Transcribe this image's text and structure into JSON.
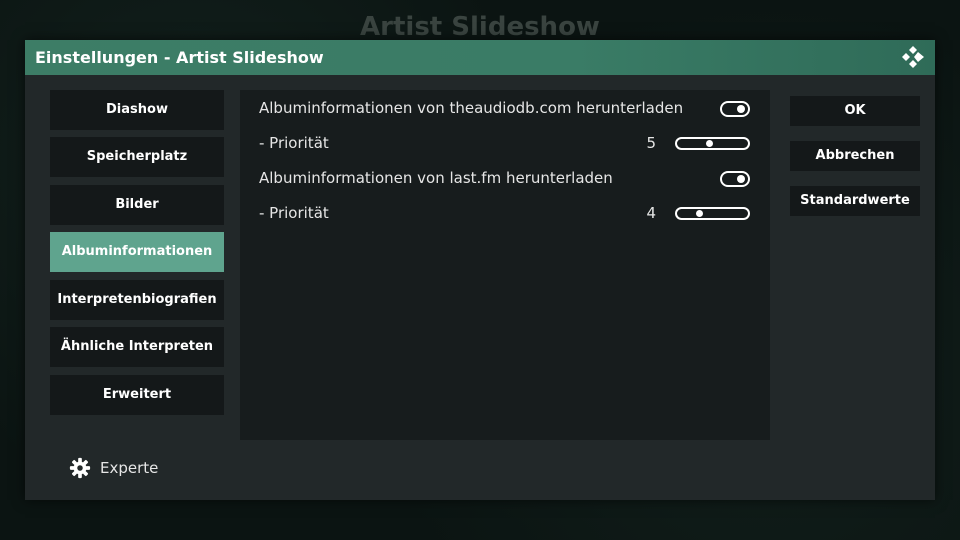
{
  "background_title": "Artist Slideshow",
  "dialog": {
    "title": "Einstellungen - Artist Slideshow"
  },
  "categories": [
    {
      "label": "Diashow",
      "active": false
    },
    {
      "label": "Speicherplatz",
      "active": false
    },
    {
      "label": "Bilder",
      "active": false
    },
    {
      "label": "Albuminformationen",
      "active": true
    },
    {
      "label": "Interpretenbiografien",
      "active": false
    },
    {
      "label": "Ähnliche Interpreten",
      "active": false
    },
    {
      "label": "Erweitert",
      "active": false
    }
  ],
  "settings": [
    {
      "type": "toggle",
      "label": "Albuminformationen von theaudiodb.com herunterladen",
      "enabled": true
    },
    {
      "type": "slider",
      "label": "- Priorität",
      "value": "5",
      "level": 0.45
    },
    {
      "type": "toggle",
      "label": "Albuminformationen von last.fm herunterladen",
      "enabled": true
    },
    {
      "type": "slider",
      "label": "- Priorität",
      "value": "4",
      "level": 0.3
    }
  ],
  "buttons": {
    "ok": "OK",
    "cancel": "Abbrechen",
    "defaults": "Standardwerte"
  },
  "settings_level": {
    "label": "Experte",
    "icon": "gear-icon"
  },
  "colors": {
    "accent": "#5fa48e",
    "header": "#3a7c66"
  }
}
